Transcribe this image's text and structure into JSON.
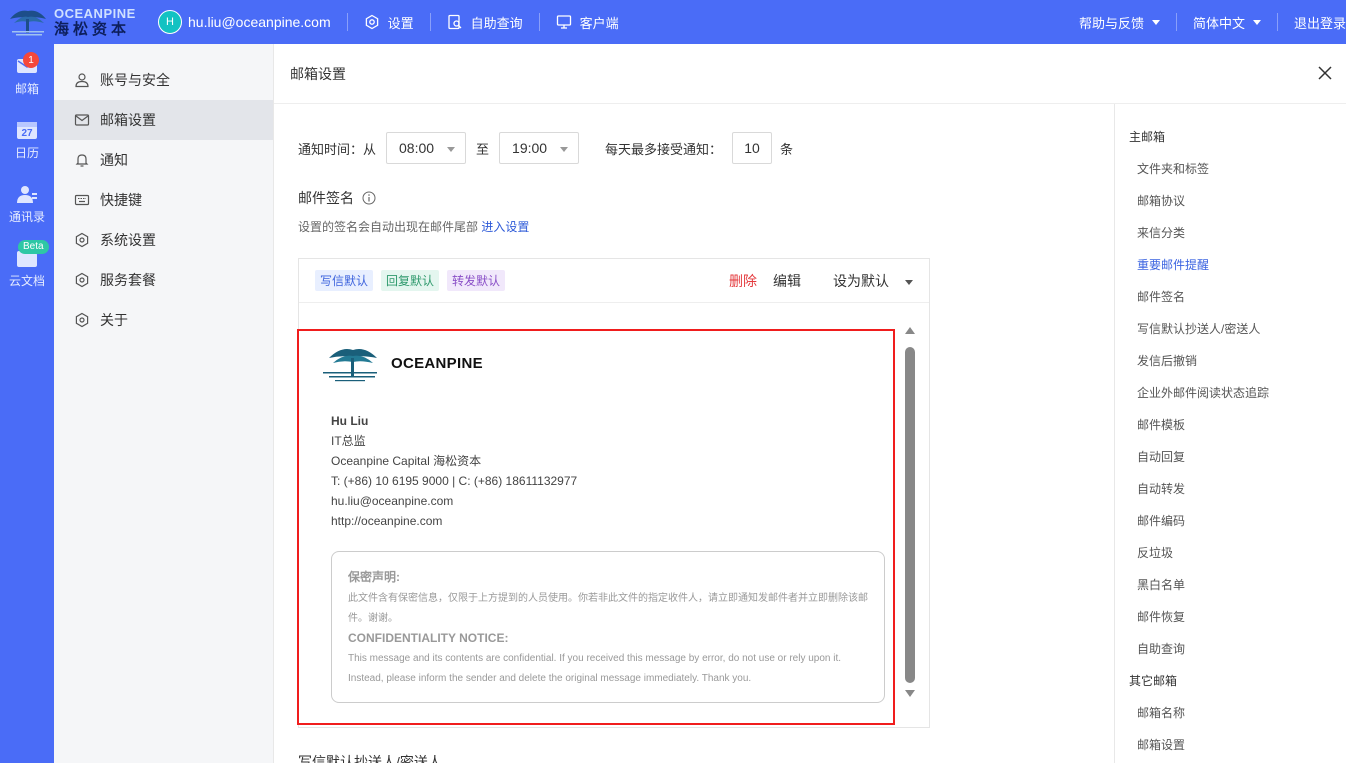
{
  "header": {
    "logo_en": "OCEANPINE",
    "logo_cn": "海松资本",
    "avatar_initial": "H",
    "user_email": "hu.liu@oceanpine.com",
    "items": [
      {
        "label": "设置",
        "icon": "gear-icon"
      },
      {
        "label": "自助查询",
        "icon": "search-doc-icon"
      },
      {
        "label": "客户端",
        "icon": "monitor-icon"
      }
    ],
    "help_label": "帮助与反馈",
    "language_label": "简体中文",
    "logout_label": "退出登录"
  },
  "rail": [
    {
      "label": "邮箱",
      "icon": "mail-icon",
      "badge": "1"
    },
    {
      "label": "日历",
      "icon": "calendar-icon",
      "date": "27"
    },
    {
      "label": "通讯录",
      "icon": "contacts-icon"
    },
    {
      "label": "云文档",
      "icon": "cloud-docs-icon",
      "badge": "Beta"
    }
  ],
  "nav": {
    "items": [
      {
        "label": "账号与安全",
        "icon": "user-icon"
      },
      {
        "label": "邮箱设置",
        "icon": "mail-icon",
        "active": true
      },
      {
        "label": "通知",
        "icon": "bell-icon"
      },
      {
        "label": "快捷键",
        "icon": "keyboard-icon"
      },
      {
        "label": "系统设置",
        "icon": "gear-icon"
      },
      {
        "label": "服务套餐",
        "icon": "gear-icon"
      },
      {
        "label": "关于",
        "icon": "gear-icon"
      }
    ]
  },
  "main": {
    "title": "邮箱设置",
    "notify": {
      "label_from": "通知时间：从",
      "from_value": "08:00",
      "label_to": "至",
      "to_value": "19:00",
      "daily_label": "每天最多接受通知：",
      "daily_value": "10",
      "daily_unit": "条"
    },
    "signature": {
      "section_title": "邮件签名",
      "hint": "设置的签名会自动出现在邮件尾部",
      "hint_link": "进入设置",
      "tags": [
        "写信默认",
        "回复默认",
        "转发默认"
      ],
      "action_delete": "删除",
      "action_edit": "编辑",
      "action_default": "设为默认",
      "logo_text": "OCEANPINE",
      "name": "Hu Liu",
      "lines": [
        "IT总监",
        "Oceanpine Capital 海松资本",
        "T: (+86) 10 6195 9000 | C: (+86) 18611132977",
        "hu.liu@oceanpine.com",
        "http://oceanpine.com"
      ],
      "conf_title_cn": "保密声明:",
      "conf_text_cn": "此文件含有保密信息，仅限于上方提到的人员使用。你若非此文件的指定收件人，请立即通知发邮件者并立即删除该邮件。谢谢。",
      "conf_title_en": "CONFIDENTIALITY NOTICE:",
      "conf_text_en": "This message and its contents are confidential. If you received this message by error, do not use or rely upon it. Instead, please inform the sender and delete the original message immediately. Thank you."
    },
    "next_section_title": "写信默认抄送人/密送人"
  },
  "anchors": {
    "group1": "主邮箱",
    "items1": [
      "文件夹和标签",
      "邮箱协议",
      "来信分类",
      "重要邮件提醒",
      "邮件签名",
      "写信默认抄送人/密送人",
      "发信后撤销",
      "企业外邮件阅读状态追踪",
      "邮件模板",
      "自动回复",
      "自动转发",
      "邮件编码",
      "反垃圾",
      "黑白名单",
      "邮件恢复",
      "自助查询"
    ],
    "active": "重要邮件提醒",
    "group2": "其它邮箱",
    "items2": [
      "邮箱名称",
      "邮箱设置"
    ]
  },
  "colors": {
    "brand": "#4A6CF7",
    "active_anchor": "#3a63e0",
    "delete": "#e4393c",
    "highlight_box": "#f01d1d"
  }
}
